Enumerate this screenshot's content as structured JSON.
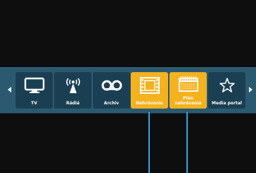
{
  "menu": {
    "items": [
      {
        "label": "TV",
        "icon": "tv-icon"
      },
      {
        "label": "Rádiá",
        "icon": "radio-antenna-icon"
      },
      {
        "label": "Archiv",
        "icon": "cassette-tape-icon"
      },
      {
        "label": "Nahrávanie",
        "icon": "film-strip-icon"
      },
      {
        "label": "Plán\nnahrávania",
        "icon": "schedule-calendar-icon"
      },
      {
        "label": "Media portal",
        "icon": "star-icon"
      }
    ]
  },
  "colors": {
    "background": "#0e0e0e",
    "bar": "#2b5a70",
    "tile": "#1b3f52",
    "active_tile": "#f5b21f",
    "pointer": "#2ea9df"
  }
}
